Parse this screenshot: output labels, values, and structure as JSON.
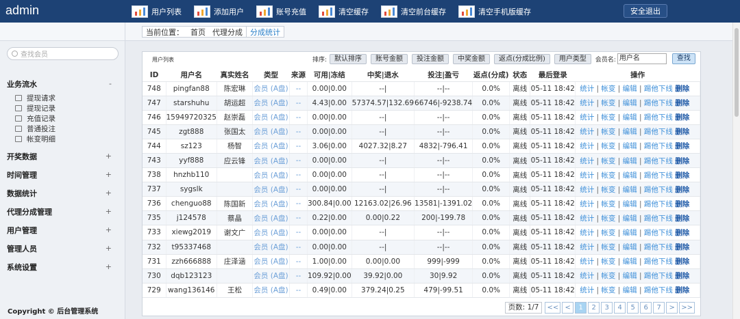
{
  "app": {
    "brand": "admin",
    "logout_label": "安全退出"
  },
  "nav": [
    {
      "label": "用户列表"
    },
    {
      "label": "添加用户"
    },
    {
      "label": "账号充值"
    },
    {
      "label": "清空缓存"
    },
    {
      "label": "清空前台缓存"
    },
    {
      "label": "清空手机版缓存"
    }
  ],
  "sidebar": {
    "search_placeholder": "查找会员",
    "groups": [
      {
        "label": "业务流水",
        "sign": "-",
        "items": [
          "提现请求",
          "提现记录",
          "充值记录",
          "普通投注",
          "帐变明细"
        ]
      },
      {
        "label": "开奖数据",
        "sign": "+"
      },
      {
        "label": "时间管理",
        "sign": "+"
      },
      {
        "label": "数据统计",
        "sign": "+"
      },
      {
        "label": "代理分成管理",
        "sign": "+"
      },
      {
        "label": "用户管理",
        "sign": "+"
      },
      {
        "label": "管理人员",
        "sign": "+"
      },
      {
        "label": "系统设置",
        "sign": "+"
      }
    ],
    "copyright": "Copyright © 后台管理系统"
  },
  "breadcrumb": {
    "prefix": "当前位置：",
    "home": "首页",
    "mid": "代理分成",
    "current": "分成统计"
  },
  "panel": {
    "title": "用户列表",
    "sort_label": "排序:",
    "sort_buttons": [
      "默认排序",
      "账号金额",
      "投注金额",
      "中奖金额",
      "返点(分成比例)",
      "用户类型"
    ],
    "member_label": "会员名:",
    "member_value": "用户名",
    "find_label": "查找"
  },
  "table": {
    "headers": [
      "ID",
      "用户名",
      "真实姓名",
      "类型",
      "来源",
      "可用|冻结",
      "中奖|退水",
      "投注|盈亏",
      "返点(分成)",
      "状态",
      "最后登录",
      "操作"
    ],
    "ops": [
      "统计",
      "帐变",
      "编辑",
      "踢他下线",
      "删除"
    ],
    "rows": [
      [
        "748",
        "pingfan88",
        "陈宏琳",
        "会员 (A盘)",
        "--",
        "0.00|0.00",
        "--|",
        "--|--",
        "0.0%",
        "离线",
        "05-11 18:42"
      ],
      [
        "747",
        "starshuhu",
        "胡运超",
        "会员 (A盘)",
        "--",
        "4.43|0.00",
        "57374.57|132.69",
        "66746|-9238.74",
        "0.0%",
        "离线",
        "05-11 18:42"
      ],
      [
        "746",
        "15949720325",
        "赵崇磊",
        "会员 (A盘)",
        "--",
        "0.00|0.00",
        "--|",
        "--|--",
        "0.0%",
        "离线",
        "05-11 18:42"
      ],
      [
        "745",
        "zgt888",
        "张国太",
        "会员 (A盘)",
        "--",
        "0.00|0.00",
        "--|",
        "--|--",
        "0.0%",
        "离线",
        "05-11 18:42"
      ],
      [
        "744",
        "sz123",
        "杨智",
        "会员 (A盘)",
        "--",
        "3.06|0.00",
        "4027.32|8.27",
        "4832|-796.41",
        "0.0%",
        "离线",
        "05-11 18:42"
      ],
      [
        "743",
        "yyf888",
        "应云锋",
        "会员 (A盘)",
        "--",
        "0.00|0.00",
        "--|",
        "--|--",
        "0.0%",
        "离线",
        "05-11 18:42"
      ],
      [
        "738",
        "hnzhb110",
        "",
        "会员 (A盘)",
        "--",
        "0.00|0.00",
        "--|",
        "--|--",
        "0.0%",
        "离线",
        "05-11 18:42"
      ],
      [
        "737",
        "sygslk",
        "",
        "会员 (A盘)",
        "--",
        "0.00|0.00",
        "--|",
        "--|--",
        "0.0%",
        "离线",
        "05-11 18:42"
      ],
      [
        "736",
        "chenguo88",
        "陈国新",
        "会员 (A盘)",
        "--",
        "300.84|0.00",
        "12163.02|26.96",
        "13581|-1391.02",
        "0.0%",
        "离线",
        "05-11 18:42"
      ],
      [
        "735",
        "j124578",
        "蔡晶",
        "会员 (A盘)",
        "--",
        "0.22|0.00",
        "0.00|0.22",
        "200|-199.78",
        "0.0%",
        "离线",
        "05-11 18:42"
      ],
      [
        "733",
        "xiewg2019",
        "谢文广",
        "会员 (A盘)",
        "--",
        "0.00|0.00",
        "--|",
        "--|--",
        "0.0%",
        "离线",
        "05-11 18:42"
      ],
      [
        "732",
        "t95337468",
        "",
        "会员 (A盘)",
        "--",
        "0.00|0.00",
        "--|",
        "--|--",
        "0.0%",
        "离线",
        "05-11 18:42"
      ],
      [
        "731",
        "zzh666888",
        "庄泽涵",
        "会员 (A盘)",
        "--",
        "1.00|0.00",
        "0.00|0.00",
        "999|-999",
        "0.0%",
        "离线",
        "05-11 18:42"
      ],
      [
        "730",
        "dqb123123",
        "",
        "会员 (A盘)",
        "--",
        "109.92|0.00",
        "39.92|0.00",
        "30|9.92",
        "0.0%",
        "离线",
        "05-11 18:42"
      ],
      [
        "729",
        "wang136146",
        "王松",
        "会员 (A盘)",
        "--",
        "0.49|0.00",
        "379.24|0.25",
        "479|-99.51",
        "0.0%",
        "离线",
        "05-11 18:42"
      ]
    ]
  },
  "pager": {
    "info": "页数: 1/7",
    "buttons": [
      "<<",
      "<",
      "1",
      "2",
      "3",
      "4",
      "5",
      "6",
      "7",
      ">",
      ">>"
    ],
    "active_page": "1"
  }
}
